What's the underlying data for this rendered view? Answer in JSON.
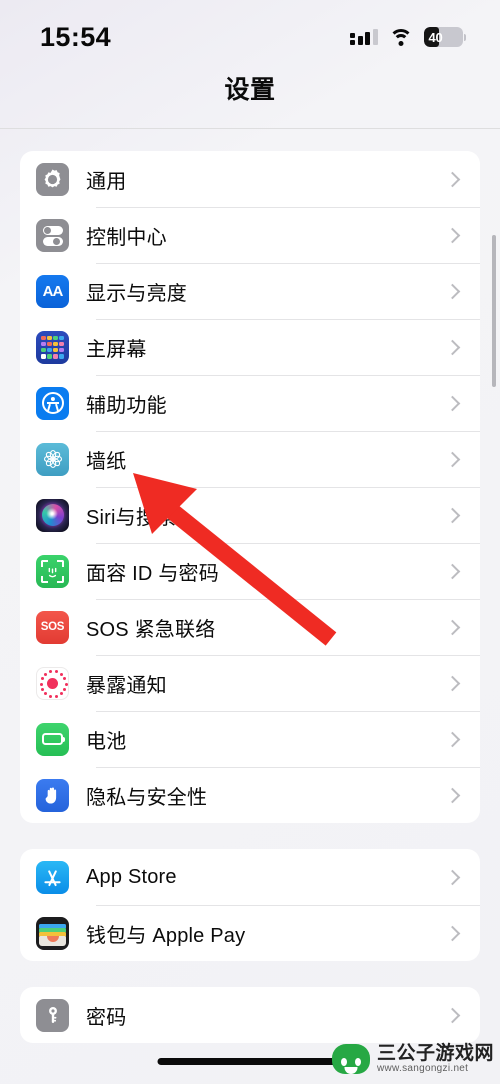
{
  "status_bar": {
    "time": "15:54",
    "battery_level": "40",
    "battery_percent": 40,
    "cellular_icon": "cellular-signal-icon",
    "wifi_icon": "wifi-icon",
    "battery_icon": "battery-icon"
  },
  "nav": {
    "title": "设置"
  },
  "colors": {
    "page_background": "#efeff4",
    "card_background": "#ffffff",
    "separator": "#e4e4e6",
    "chevron": "#bcbcc0",
    "annotation_red": "#ef2b23",
    "gray_icon": "#8e8e93",
    "blue_icon": "#0a7cf0",
    "green_icon": "#28b855",
    "red_icon": "#e23b33"
  },
  "groups": [
    {
      "rows": [
        {
          "label": "通用",
          "icon": "gear-icon"
        },
        {
          "label": "控制中心",
          "icon": "control-center-icon"
        },
        {
          "label": "显示与亮度",
          "icon": "display-brightness-icon"
        },
        {
          "label": "主屏幕",
          "icon": "home-screen-icon"
        },
        {
          "label": "辅助功能",
          "icon": "accessibility-icon"
        },
        {
          "label": "墙纸",
          "icon": "wallpaper-icon"
        },
        {
          "label": "Siri与搜索",
          "icon": "siri-icon"
        },
        {
          "label": "面容 ID 与密码",
          "icon": "face-id-icon"
        },
        {
          "label": "SOS 紧急联络",
          "icon": "sos-icon"
        },
        {
          "label": "暴露通知",
          "icon": "exposure-notification-icon"
        },
        {
          "label": "电池",
          "icon": "battery-settings-icon"
        },
        {
          "label": "隐私与安全性",
          "icon": "privacy-hand-icon"
        }
      ]
    },
    {
      "rows": [
        {
          "label": "App Store",
          "icon": "app-store-icon"
        },
        {
          "label": "钱包与 Apple Pay",
          "icon": "wallet-icon"
        }
      ]
    },
    {
      "rows": [
        {
          "label": "密码",
          "icon": "key-icon"
        }
      ]
    }
  ],
  "annotation": {
    "type": "arrow",
    "color": "#ef2b23",
    "points_at": "墙纸"
  },
  "watermark": {
    "title": "三公子游戏网",
    "url": "www.sangongzi.net"
  }
}
